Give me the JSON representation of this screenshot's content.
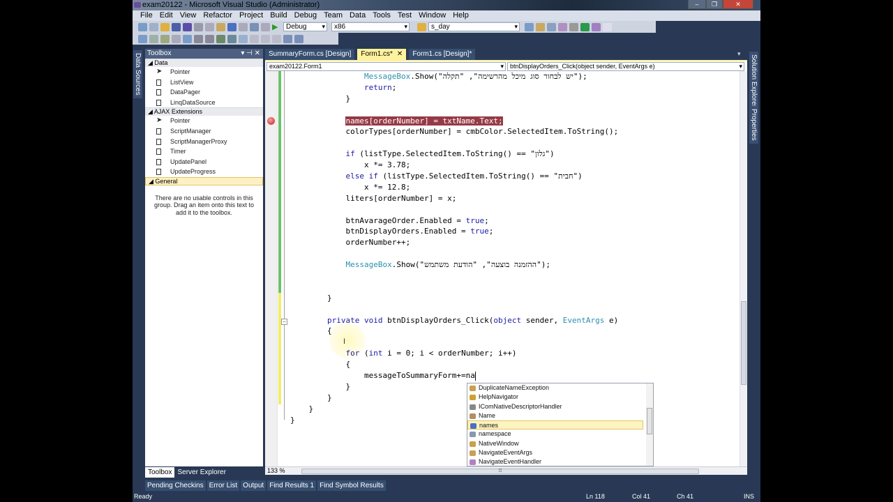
{
  "window": {
    "title": "exam20122 - Microsoft Visual Studio (Administrator)",
    "controls": [
      "–",
      "❐",
      "✕"
    ]
  },
  "menu": [
    "File",
    "Edit",
    "View",
    "Refactor",
    "Project",
    "Build",
    "Debug",
    "Team",
    "Data",
    "Tools",
    "Test",
    "Window",
    "Help"
  ],
  "toolbar": {
    "config": "Debug",
    "platform": "x86",
    "find": "s_day"
  },
  "left_vtab": "Data Sources",
  "right_vtabs": [
    "Solution Explorer",
    "Properties"
  ],
  "toolbox": {
    "title": "Toolbox",
    "controls": "▾ ⊣ ✕",
    "categories": [
      {
        "name": "◢ Data",
        "items": [
          "Pointer",
          "ListView",
          "DataPager",
          "LinqDataSource"
        ]
      },
      {
        "name": "◢ AJAX Extensions",
        "items": [
          "Pointer",
          "ScriptManager",
          "ScriptManagerProxy",
          "Timer",
          "UpdatePanel",
          "UpdateProgress"
        ]
      },
      {
        "name": "◢ General",
        "items": [],
        "selected": true
      }
    ],
    "empty_text": "There are no usable controls in this group. Drag an item onto this text to add it to the toolbox."
  },
  "toolbox_tabs": [
    "Toolbox",
    "Server Explorer"
  ],
  "doc_tabs": [
    {
      "label": "SummaryForm.cs [Design]"
    },
    {
      "label": "Form1.cs*",
      "active": true,
      "close": "✕"
    },
    {
      "label": "Form1.cs [Design]*"
    }
  ],
  "navbar": {
    "type": "exam20122.Form1",
    "member": "btnDisplayOrders_Click(object sender, EventArgs e)"
  },
  "code": {
    "lines": [
      [
        [
          "                ",
          ""
        ],
        [
          "MessageBox",
          "type"
        ],
        [
          ".Show(\"יש לבחור סוג מיכל מהרשימה\", \"תקלה\");",
          ""
        ]
      ],
      [
        [
          "                ",
          ""
        ],
        [
          "return",
          "kw"
        ],
        [
          ";",
          ""
        ]
      ],
      [
        [
          "            }",
          ""
        ]
      ],
      [],
      [
        [
          "            ",
          ""
        ],
        [
          "names[orderNumber] = txtName.Text;",
          "bp"
        ]
      ],
      [
        [
          "            colorTypes[orderNumber] = cmbColor.SelectedItem.ToString();",
          ""
        ]
      ],
      [],
      [
        [
          "            ",
          ""
        ],
        [
          "if",
          "kw"
        ],
        [
          " (listType.SelectedItem.ToString() == \"גלון\")",
          ""
        ]
      ],
      [
        [
          "                x *= 3.78;",
          ""
        ]
      ],
      [
        [
          "            ",
          ""
        ],
        [
          "else if",
          "kw"
        ],
        [
          " (listType.SelectedItem.ToString() == \"חבית\")",
          ""
        ]
      ],
      [
        [
          "                x *= 12.8;",
          ""
        ]
      ],
      [
        [
          "            liters[orderNumber] = x;",
          ""
        ]
      ],
      [],
      [
        [
          "            btnAvarageOrder.Enabled = ",
          ""
        ],
        [
          "true",
          "kw"
        ],
        [
          ";",
          ""
        ]
      ],
      [
        [
          "            btnDisplayOrders.Enabled = ",
          ""
        ],
        [
          "true",
          "kw"
        ],
        [
          ";",
          ""
        ]
      ],
      [
        [
          "            orderNumber++;",
          ""
        ]
      ],
      [],
      [
        [
          "            ",
          ""
        ],
        [
          "MessageBox",
          "type"
        ],
        [
          ".Show(\"ההזמנה בוצעה\", \"הודעת משתמש\");",
          ""
        ]
      ],
      [],
      [],
      [
        [
          "        }",
          ""
        ]
      ],
      [],
      [
        [
          "        ",
          ""
        ],
        [
          "private void",
          "kw"
        ],
        [
          " btnDisplayOrders_Click(",
          ""
        ],
        [
          "object",
          "kw"
        ],
        [
          " sender, ",
          ""
        ],
        [
          "EventArgs",
          "type"
        ],
        [
          " e)",
          ""
        ]
      ],
      [
        [
          "        {",
          ""
        ]
      ],
      [],
      [
        [
          "            ",
          ""
        ],
        [
          "for",
          "kw"
        ],
        [
          " (",
          ""
        ],
        [
          "int",
          "kw"
        ],
        [
          " i = 0; i < orderNumber; i++)",
          ""
        ]
      ],
      [
        [
          "            {",
          ""
        ]
      ],
      [
        [
          "                messageToSummaryForm+=na",
          ""
        ]
      ],
      [
        [
          "            }",
          ""
        ]
      ],
      [
        [
          "        }",
          ""
        ]
      ],
      [
        [
          "    }",
          ""
        ]
      ],
      [
        [
          "}",
          ""
        ]
      ]
    ],
    "caret_line": 27
  },
  "intellisense": {
    "items": [
      {
        "label": "DuplicateNameException",
        "icon": "class-icon"
      },
      {
        "label": "HelpNavigator",
        "icon": "enum-icon"
      },
      {
        "label": "IComNativeDescriptorHandler",
        "icon": "interface-icon"
      },
      {
        "label": "Name",
        "icon": "property-icon"
      },
      {
        "label": "names",
        "icon": "field-icon",
        "selected": true
      },
      {
        "label": "namespace",
        "icon": "keyword-icon"
      },
      {
        "label": "NativeWindow",
        "icon": "class-icon"
      },
      {
        "label": "NavigateEventArgs",
        "icon": "class-icon"
      },
      {
        "label": "NavigateEventHandler",
        "icon": "delegate-icon"
      }
    ]
  },
  "editor": {
    "zoom": "133 %"
  },
  "bottom_tabs": [
    "Pending Checkins",
    "Error List",
    "Output",
    "Find Results 1",
    "Find Symbol Results"
  ],
  "status": {
    "state": "Ready",
    "ln": "Ln 118",
    "col": "Col 41",
    "ch": "Ch 41",
    "mode": "INS"
  },
  "colors": {
    "keyword": "#1a1aa6",
    "type": "#2b91af",
    "breakpoint_line": "#963a46",
    "chrome": "#293955",
    "active_tab": "#fff29d"
  }
}
